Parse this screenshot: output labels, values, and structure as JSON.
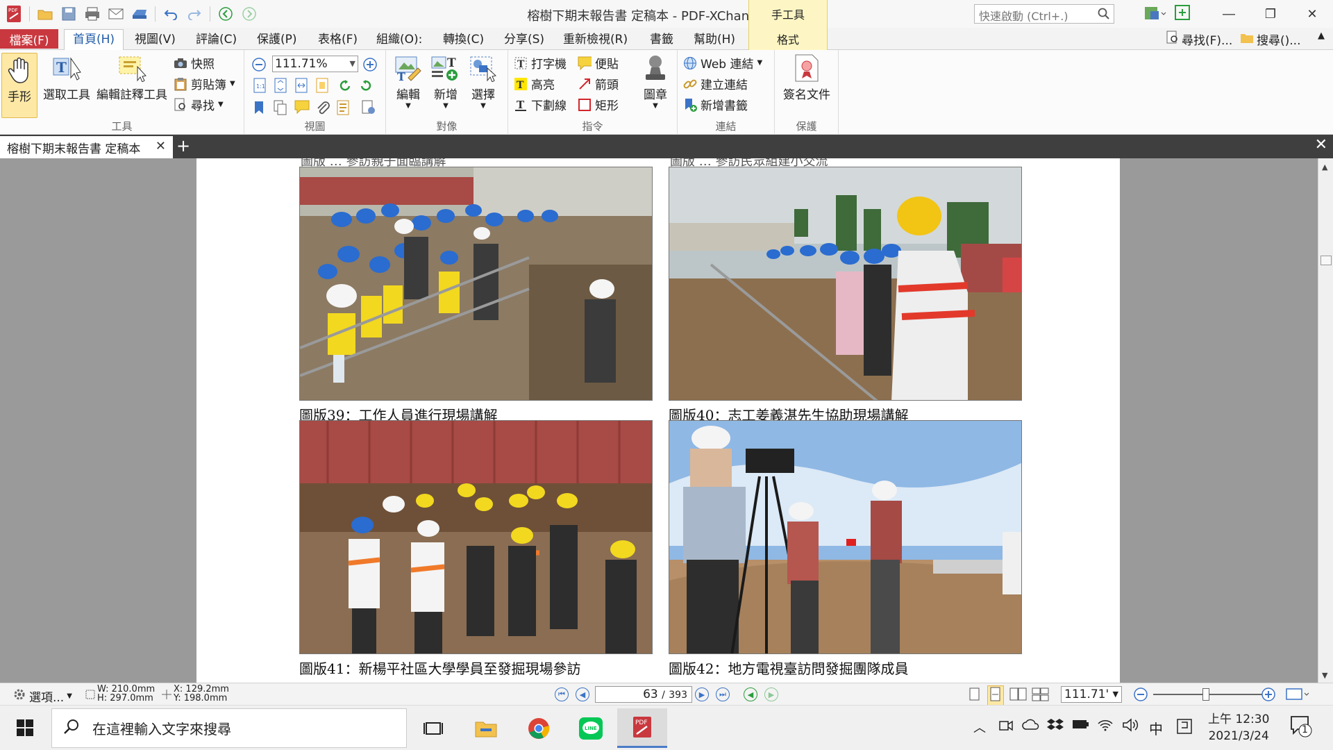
{
  "titlebar": {
    "window_title": "榕樹下期末報告書 定稿本 - PDF-XChange Editor",
    "context_tab_group": "手工具",
    "quick_launch_placeholder": "快速啟動 (Ctrl+.)"
  },
  "ribbon_tabs": {
    "file": "檔案(F)",
    "tabs": [
      "首頁(H)",
      "視圖(V)",
      "評論(C)",
      "保護(P)",
      "表格(F)",
      "組織(O):",
      "轉換(C)",
      "分享(S)",
      "重新檢視(R)",
      "書籤",
      "幫助(H)"
    ],
    "context_sub": "格式",
    "find": "尋找(F)...",
    "search": "搜尋()..."
  },
  "ribbon": {
    "tools": {
      "label": "工具",
      "hand": "手形",
      "select_text": "選取工具",
      "edit_annot": "編輯註釋工具",
      "snapshot": "快照",
      "clipboard": "剪貼簿",
      "find": "尋找"
    },
    "view": {
      "label": "視圖",
      "zoom": "111.71%"
    },
    "objects": {
      "label": "對像",
      "edit": "編輯",
      "add": "新增",
      "select": "選擇"
    },
    "commands": {
      "label": "指令",
      "typewriter": "打字機",
      "sticky": "便貼",
      "highlight": "高亮",
      "arrow": "箭頭",
      "underline": "下劃線",
      "rect": "矩形",
      "stamp": "圖章"
    },
    "links": {
      "label": "連結",
      "web_links": "Web 連結",
      "create_link": "建立連結",
      "add_bookmark": "新增書籤"
    },
    "protect": {
      "label": "保護",
      "sign": "簽名文件"
    }
  },
  "doc_tab": {
    "name": "榕樹下期末報告書 定稿本"
  },
  "page": {
    "captions": [
      "圖版39：工作人員進行現場講解",
      "圖版40：志工姜義湛先生協助現場講解",
      "圖版41：新楊平社區大學學員至發掘現場參訪",
      "圖版42：地方電視臺訪問發掘團隊成員"
    ],
    "top_cut": [
      "圖版 … 參訪親子面臨講解",
      "圖版 … 參訪民眾組建小交流"
    ]
  },
  "statusbar": {
    "options": "選項...",
    "width": "W: 210.0mm",
    "height": "H: 297.0mm",
    "x": "X: 129.2mm",
    "y": "Y: 198.0mm",
    "page_current": "63",
    "page_total": "393",
    "zoom": "111.71'"
  },
  "taskbar": {
    "search_placeholder": "在這裡輸入文字來搜尋",
    "ime": "中",
    "time": "上午 12:30",
    "date": "2021/3/24",
    "notifications": "1"
  },
  "colors": {
    "file_tab": "#c9383f",
    "accent": "#1f5aa7",
    "context": "#fdf6c4",
    "doc_bg": "#9a9a9a"
  }
}
